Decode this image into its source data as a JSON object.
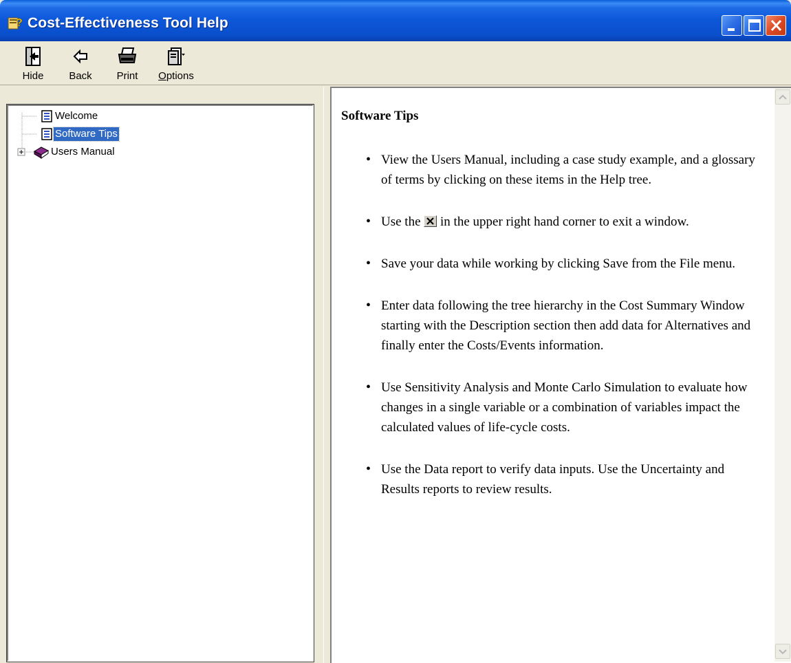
{
  "window": {
    "title": "Cost-Effectiveness Tool Help"
  },
  "toolbar": {
    "hide_label": "Hide",
    "back_label": "Back",
    "print_label": "Print",
    "options_label": "Options"
  },
  "tree": {
    "items": [
      {
        "label": "Welcome",
        "icon": "page-icon"
      },
      {
        "label": "Software Tips",
        "icon": "page-icon",
        "selected": true
      },
      {
        "label": "Users Manual",
        "icon": "book-icon",
        "expandable": true
      }
    ]
  },
  "content": {
    "heading": "Software Tips",
    "bullets": [
      "View the Users Manual, including a case study example, and a glossary of terms by clicking on these items in the Help tree.",
      "Use the",
      "in the upper right hand corner to exit a window.",
      "Save your data while working by clicking Save from the File menu.",
      "Enter data following the tree hierarchy in the Cost Summary Window starting with the Description section then add data for Alternatives and finally enter the Costs/Events information.",
      "Use Sensitivity Analysis and Monte Carlo Simulation to evaluate how changes in a single variable or a combination of variables impact the calculated values of life-cycle costs.",
      "Use the Data report to verify data inputs.  Use the Uncertainty and Results reports to review results."
    ]
  },
  "colors": {
    "titlebar": "#0a4fcc",
    "selection": "#316ac5",
    "close_button": "#dc4a24"
  }
}
